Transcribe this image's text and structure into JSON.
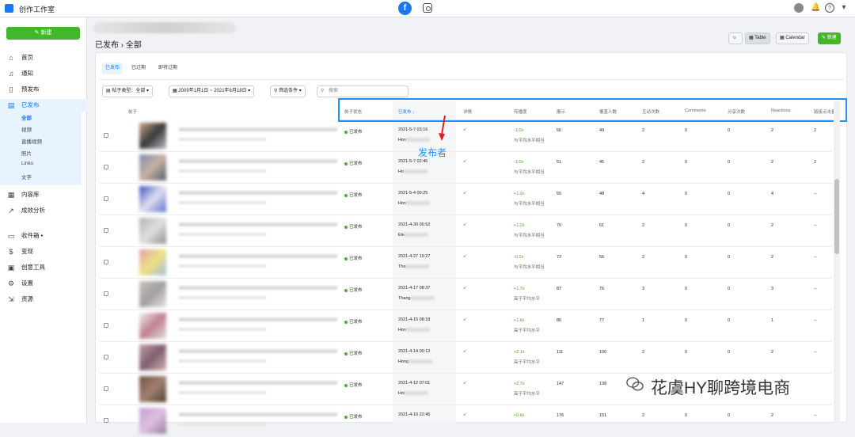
{
  "app": {
    "title": "创作工作室"
  },
  "sidebar": {
    "new_label": "新建",
    "items": [
      {
        "label": "首页",
        "icon": "home-icon"
      },
      {
        "label": "通知",
        "icon": "bell-icon"
      },
      {
        "label": "预发布",
        "icon": "document-icon"
      },
      {
        "label": "已发布",
        "icon": "published-icon"
      },
      {
        "label": "内容库",
        "icon": "library-icon"
      },
      {
        "label": "成效分析",
        "icon": "chart-icon"
      },
      {
        "label": "收件箱 •",
        "icon": "inbox-icon"
      },
      {
        "label": "变现",
        "icon": "dollar-icon"
      },
      {
        "label": "创意工具",
        "icon": "tools-icon"
      },
      {
        "label": "设置",
        "icon": "gear-icon"
      },
      {
        "label": "资源",
        "icon": "resource-icon"
      }
    ],
    "subitems": [
      "全部",
      "视频",
      "直播视频",
      "照片",
      "Links",
      "文字"
    ]
  },
  "breadcrumb": "已发布 › 全部",
  "toolbar": {
    "table": "Table",
    "calendar": "Calendar",
    "create": "新建"
  },
  "tabs": [
    "已发布",
    "已过期",
    "即将过期"
  ],
  "filters": {
    "post_type": "帖子类型：全部",
    "date_range": "2009年1月1日 ~ 2021年6月18日",
    "conditions": "筛选条件",
    "search_placeholder": "搜索"
  },
  "table": {
    "title_header": "帖子",
    "headers": [
      "帖子状态",
      "已发布 ↓",
      "详情",
      "传播度",
      "展示",
      "覆盖人数",
      "互动次数",
      "Comments",
      "分享次数",
      "Reactions",
      "链接点击量"
    ],
    "rows": [
      {
        "status": "已发布",
        "date": "2021-5-7 03:16",
        "author": "Hon",
        "dist": "-1.0x",
        "dist_note": "与平均水平相当",
        "imp": "56",
        "reach": "49",
        "eng": "2",
        "com": "0",
        "share": "0",
        "react": "2",
        "clicks": "2"
      },
      {
        "status": "已发布",
        "date": "2021-5-7 02:46",
        "author": "Ho",
        "dist": "-1.0x",
        "dist_note": "与平均水平相当",
        "imp": "51",
        "reach": "45",
        "eng": "2",
        "com": "0",
        "share": "0",
        "react": "2",
        "clicks": "2"
      },
      {
        "status": "已发布",
        "date": "2021-5-4 00:25",
        "author": "Hon",
        "dist": "+1.0x",
        "dist_note": "与平均水平相当",
        "imp": "55",
        "reach": "48",
        "eng": "4",
        "com": "0",
        "share": "0",
        "react": "4",
        "clicks": "--"
      },
      {
        "status": "已发布",
        "date": "2021-4-30 05:52",
        "author": "Ele",
        "dist": "+1.2x",
        "dist_note": "与平均水平相当",
        "imp": "70",
        "reach": "61",
        "eng": "2",
        "com": "0",
        "share": "0",
        "react": "2",
        "clicks": "--"
      },
      {
        "status": "已发布",
        "date": "2021-4-27 19:27",
        "author": "Tha",
        "dist": "-0.2x",
        "dist_note": "与平均水平相当",
        "imp": "72",
        "reach": "56",
        "eng": "2",
        "com": "0",
        "share": "0",
        "react": "2",
        "clicks": "--"
      },
      {
        "status": "已发布",
        "date": "2021-4-17 08:37",
        "author": "Thang",
        "dist": "+1.7x",
        "dist_note": "高于平均水平",
        "imp": "87",
        "reach": "76",
        "eng": "3",
        "com": "0",
        "share": "0",
        "react": "3",
        "clicks": "--"
      },
      {
        "status": "已发布",
        "date": "2021-4-15 08:18",
        "author": "Hon",
        "dist": "+1.6x",
        "dist_note": "高于平均水平",
        "imp": "86",
        "reach": "77",
        "eng": "1",
        "com": "0",
        "share": "0",
        "react": "1",
        "clicks": "--"
      },
      {
        "status": "已发布",
        "date": "2021-4-14 00:12",
        "author": "Hong",
        "dist": "+2.1x",
        "dist_note": "高于平均水平",
        "imp": "111",
        "reach": "100",
        "eng": "2",
        "com": "0",
        "share": "0",
        "react": "2",
        "clicks": "--"
      },
      {
        "status": "已发布",
        "date": "2021-4-12 07:01",
        "author": "Hoi",
        "dist": "+2.7x",
        "dist_note": "高于平均水平",
        "imp": "147",
        "reach": "138",
        "eng": "",
        "com": "",
        "share": "",
        "react": "",
        "clicks": ""
      },
      {
        "status": "已发布",
        "date": "2021-4-10 22:45",
        "author": "",
        "dist": "+0.6x",
        "dist_note": "",
        "imp": "176",
        "reach": "151",
        "eng": "2",
        "com": "0",
        "share": "0",
        "react": "2",
        "clicks": "--"
      }
    ]
  },
  "annotation": "发布者",
  "watermark": "花虞HY聊跨境电商",
  "colors": {
    "accent": "#1877f2",
    "green": "#42b72a",
    "highlight": "#1e90ff"
  }
}
